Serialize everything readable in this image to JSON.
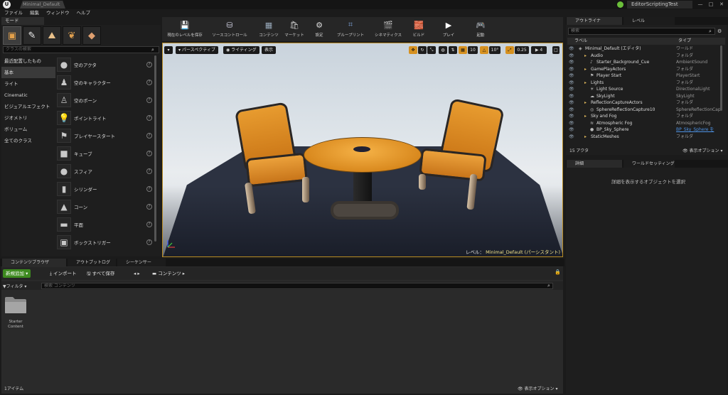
{
  "window": {
    "doc_tab": "Minimal_Default",
    "project_name": "EditorScriptingTest",
    "controls": [
      "—",
      "□",
      "✕"
    ]
  },
  "menu": [
    "ファイル",
    "編集",
    "ウィンドウ",
    "ヘルプ"
  ],
  "modes": {
    "tab_label": "モード",
    "search_placeholder": "クラスの検索",
    "categories": [
      "最近配置したもの",
      "基本",
      "ライト",
      "Cinematic",
      "ビジュアルエフェクト",
      "ジオメトリ",
      "ボリューム",
      "全てのクラス"
    ],
    "selected_category": "基本",
    "items": [
      {
        "label": "空のアクタ",
        "icon": "sphere-icon",
        "glyph": "●"
      },
      {
        "label": "空のキャラクター",
        "icon": "character-icon",
        "glyph": "♟"
      },
      {
        "label": "空のポーン",
        "icon": "pawn-icon",
        "glyph": "♙"
      },
      {
        "label": "ポイントライト",
        "icon": "lightbulb-icon",
        "glyph": "💡"
      },
      {
        "label": "プレイヤースタート",
        "icon": "player-start-icon",
        "glyph": "⚑"
      },
      {
        "label": "キューブ",
        "icon": "cube-icon",
        "glyph": "■"
      },
      {
        "label": "スフィア",
        "icon": "sphere-icon",
        "glyph": "●"
      },
      {
        "label": "シリンダー",
        "icon": "cylinder-icon",
        "glyph": "▮"
      },
      {
        "label": "コーン",
        "icon": "cone-icon",
        "glyph": "▲"
      },
      {
        "label": "平面",
        "icon": "plane-icon",
        "glyph": "▬"
      },
      {
        "label": "ボックストリガー",
        "icon": "box-trigger-icon",
        "glyph": "▣"
      }
    ]
  },
  "toolbar": {
    "buttons": [
      {
        "label": "現在のレベルを保存",
        "icon": "save-icon"
      },
      {
        "label": "ソースコントロール",
        "icon": "source-control-icon"
      },
      {
        "label": "コンテンツ",
        "icon": "content-icon"
      },
      {
        "label": "マーケット",
        "icon": "marketplace-icon"
      },
      {
        "label": "設定",
        "icon": "settings-icon"
      },
      {
        "label": "ブループリント",
        "icon": "blueprint-icon"
      },
      {
        "label": "シネマティクス",
        "icon": "cinematics-icon"
      },
      {
        "label": "ビルド",
        "icon": "build-icon"
      },
      {
        "label": "プレイ",
        "icon": "play-icon"
      },
      {
        "label": "起動",
        "icon": "launch-icon"
      }
    ]
  },
  "viewport": {
    "perspective_label": "パースペクティブ",
    "lighting_label": "ライティング",
    "show_label": "表示",
    "grid_snap": "10",
    "rotation_snap": "10°",
    "scale_snap": "0.25",
    "camera_speed": "4",
    "level_prefix": "レベル：",
    "level_name": "Minimal_Default (パーシスタント)"
  },
  "outliner": {
    "tab_label": "アウトライナ",
    "levels_tab_label": "レベル",
    "search_placeholder": "検索",
    "col_label": "ラベル",
    "col_type": "タイプ",
    "rows": [
      {
        "label": "Minimal_Default (エディタ)",
        "type": "ワールド",
        "indent": 0,
        "glyph": "◈"
      },
      {
        "label": "Audio",
        "type": "フォルダ",
        "indent": 1,
        "glyph": "▸"
      },
      {
        "label": "Starter_Background_Cue",
        "type": "AmbientSound",
        "indent": 2,
        "glyph": "♪"
      },
      {
        "label": "GamePlayActors",
        "type": "フォルダ",
        "indent": 1,
        "glyph": "▸"
      },
      {
        "label": "Player Start",
        "type": "PlayerStart",
        "indent": 2,
        "glyph": "⚑"
      },
      {
        "label": "Lights",
        "type": "フォルダ",
        "indent": 1,
        "glyph": "▸"
      },
      {
        "label": "Light Source",
        "type": "DirectionalLight",
        "indent": 2,
        "glyph": "☀"
      },
      {
        "label": "SkyLight",
        "type": "SkyLight",
        "indent": 2,
        "glyph": "☁"
      },
      {
        "label": "ReflectionCaptureActors",
        "type": "フォルダ",
        "indent": 1,
        "glyph": "▸"
      },
      {
        "label": "SphereReflectionCapture10",
        "type": "SphereReflectionCap",
        "indent": 2,
        "glyph": "◎"
      },
      {
        "label": "Sky and Fog",
        "type": "フォルダ",
        "indent": 1,
        "glyph": "▸"
      },
      {
        "label": "Atmospheric Fog",
        "type": "AtmosphericFog",
        "indent": 2,
        "glyph": "≋"
      },
      {
        "label": "BP_Sky_Sphere",
        "type": "BP_Sky_Sphere を",
        "indent": 2,
        "glyph": "●",
        "link": true
      },
      {
        "label": "StaticMeshes",
        "type": "フォルダ",
        "indent": 1,
        "glyph": "▸"
      }
    ],
    "count": "15 アクタ",
    "view_options": "表示オプション ▾"
  },
  "details": {
    "tab_label": "詳細",
    "world_settings_tab": "ワールドセッティング",
    "empty_text": "詳細を表示するオブジェクトを選択"
  },
  "content_browser": {
    "tabs": [
      "コンテンツブラウザ",
      "アウトプットログ",
      "シーケンサー"
    ],
    "add_new": "新規追加 ▾",
    "import": "インポート",
    "save_all": "すべて保存",
    "path": "コンテンツ",
    "filters": "フィルタ ▾",
    "search_placeholder": "検索 コンテンツ",
    "folder_label": "Starter Content",
    "count": "1アイテム",
    "view_options": "表示オプション ▾"
  },
  "colors": {
    "accent_orange": "#d69120",
    "add_new_green": "#3d8a1f",
    "link_blue": "#4e93e6"
  }
}
